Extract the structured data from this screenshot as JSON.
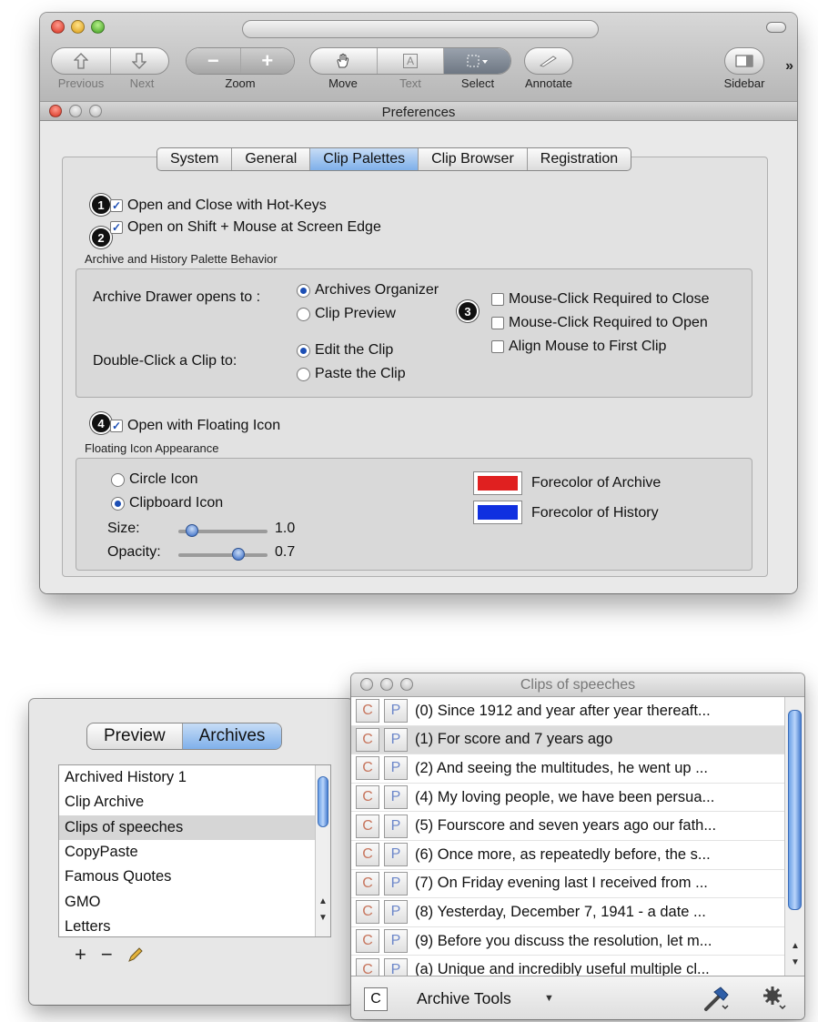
{
  "toolbar": {
    "buttons": [
      {
        "label": "Previous",
        "icon": "up-arrow-icon"
      },
      {
        "label": "Next",
        "icon": "down-arrow-icon"
      },
      {
        "label": "Zoom"
      },
      {
        "label": "Move",
        "icon": "hand-icon"
      },
      {
        "label": "Text",
        "icon": "text-icon"
      },
      {
        "label": "Select",
        "icon": "selection-icon"
      },
      {
        "label": "Annotate",
        "icon": "pencil-icon"
      },
      {
        "label": "Sidebar",
        "icon": "sidebar-icon"
      }
    ],
    "zoom_out": "−",
    "zoom_in": "+",
    "text_glyph": "A",
    "more": "»"
  },
  "prefs": {
    "title": "Preferences",
    "tabs": [
      "System",
      "General",
      "Clip Palettes",
      "Clip Browser",
      "Registration"
    ],
    "active_tab": "Clip Palettes",
    "hotkeys": "Open and Close with Hot-Keys",
    "shift_mouse": "Open on Shift + Mouse at Screen Edge",
    "archive_group_label": "Archive and History Palette Behavior",
    "drawer_label": "Archive Drawer opens to :",
    "drawer_options": [
      "Archives Organizer",
      "Clip Preview"
    ],
    "doubleclick_label": "Double-Click a Clip to:",
    "doubleclick_options": [
      "Edit the Clip",
      "Paste the Clip"
    ],
    "mouse_options": [
      "Mouse-Click Required to Close",
      "Mouse-Click Required to Open",
      "Align Mouse to First Clip"
    ],
    "floating": "Open with Floating Icon",
    "floating_group_label": "Floating Icon Appearance",
    "icon_options": [
      "Circle Icon",
      "Clipboard Icon"
    ],
    "size_label": "Size:",
    "size_value": "1.0",
    "size_fraction": 0.1,
    "opacity_label": "Opacity:",
    "opacity_value": "0.7",
    "opacity_fraction": 0.7,
    "archive_color_label": "Forecolor of Archive",
    "history_color_label": "Forecolor of History",
    "archive_color": "#e02020",
    "history_color": "#1030e0",
    "badges": [
      "1",
      "2",
      "3",
      "4"
    ]
  },
  "archives_window": {
    "tabs": [
      "Preview",
      "Archives"
    ],
    "active_tab": "Archives",
    "items": [
      "Archived History 1",
      "Clip Archive",
      "Clips of speeches",
      "CopyPaste",
      "Famous Quotes",
      "GMO",
      "Letters"
    ],
    "selected": "Clips of speeches",
    "add": "+",
    "remove": "−"
  },
  "clips_window": {
    "title": "Clips of speeches",
    "c_label": "C",
    "p_label": "P",
    "clips": [
      "(0) Since 1912 and year after year thereaft...",
      "(1) For score and 7 years ago",
      "(2) And seeing the multitudes, he went up ...",
      "(4) My loving people, we have been persua...",
      "(5) Fourscore and seven years ago our fath...",
      "(6) Once more, as repeatedly before, the s...",
      "(7) On Friday evening last I received from ...",
      "(8) Yesterday, December 7, 1941 - a date ...",
      "(9) Before you discuss the resolution, let m...",
      "(a) Unique and incredibly useful multiple cl..."
    ],
    "selected_index": 1,
    "tools_label": "Archive Tools"
  }
}
